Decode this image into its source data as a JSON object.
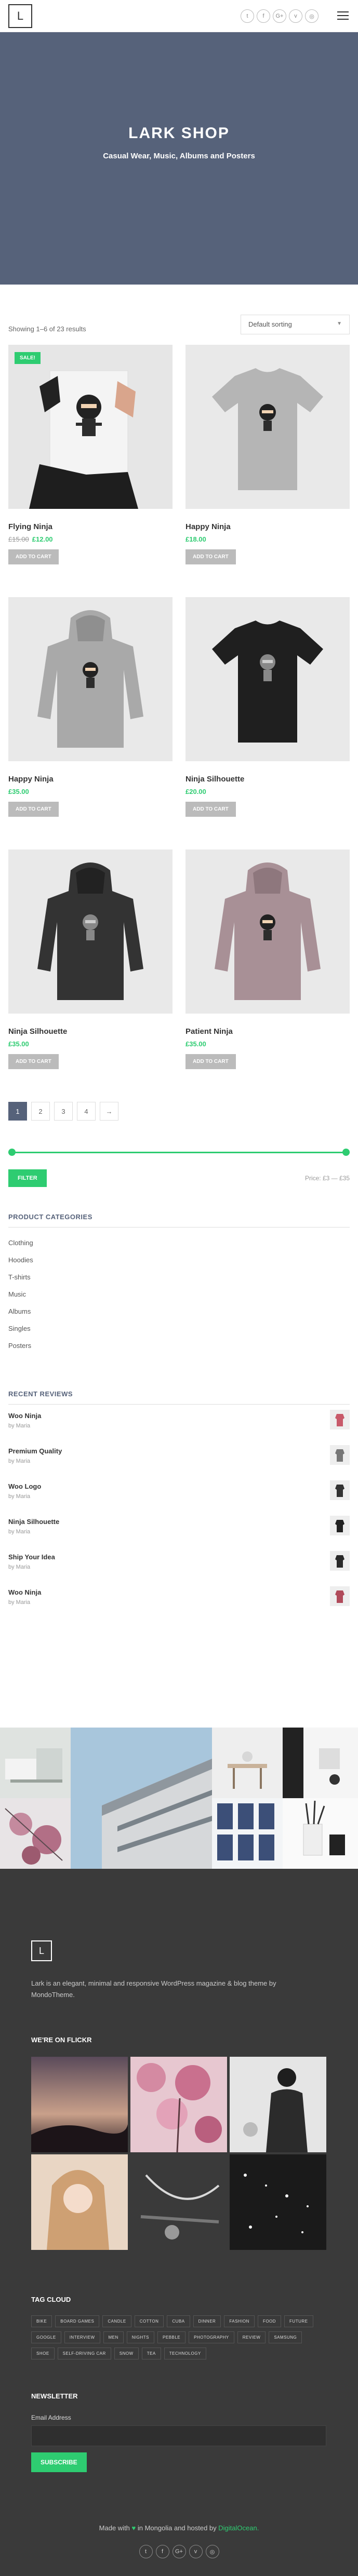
{
  "header": {
    "logo_letter": "L",
    "socials": [
      {
        "icon": "twitter-icon",
        "glyph": "t"
      },
      {
        "icon": "facebook-icon",
        "glyph": "f"
      },
      {
        "icon": "google-plus-icon",
        "glyph": "G+"
      },
      {
        "icon": "vimeo-icon",
        "glyph": "v"
      },
      {
        "icon": "dribbble-icon",
        "glyph": "◎"
      }
    ]
  },
  "hero": {
    "title": "LARK SHOP",
    "subtitle": "Casual Wear, Music, Albums and Posters"
  },
  "shop": {
    "result_count": "Showing 1–6 of 23 results",
    "sorting": "Default sorting",
    "sale_label": "SALE!",
    "add_to_cart": "ADD TO CART",
    "products": [
      {
        "name": "Flying Ninja",
        "old_price": "£15.00",
        "price": "£12.00",
        "sale": true,
        "kind": "poster",
        "color": "#e0e0e0"
      },
      {
        "name": "Happy Ninja",
        "old_price": "",
        "price": "£18.00",
        "sale": false,
        "kind": "tshirt",
        "color": "#b5b5b5"
      },
      {
        "name": "Happy Ninja",
        "old_price": "",
        "price": "£35.00",
        "sale": false,
        "kind": "hoodie",
        "color": "#a9a9a9"
      },
      {
        "name": "Ninja Silhouette",
        "old_price": "",
        "price": "£20.00",
        "sale": false,
        "kind": "tshirt",
        "color": "#1f1f1f"
      },
      {
        "name": "Ninja Silhouette",
        "old_price": "",
        "price": "£35.00",
        "sale": false,
        "kind": "hoodie",
        "color": "#333333"
      },
      {
        "name": "Patient Ninja",
        "old_price": "",
        "price": "£35.00",
        "sale": false,
        "kind": "hoodie",
        "color": "#a89096"
      }
    ],
    "pages": [
      "1",
      "2",
      "3",
      "4",
      "→"
    ]
  },
  "filter": {
    "button": "FILTER",
    "price_label": "Price: £3 — £35"
  },
  "categories": {
    "title": "PRODUCT CATEGORIES",
    "items": [
      "Clothing",
      "Hoodies",
      "T-shirts",
      "Music",
      "Albums",
      "Singles",
      "Posters"
    ]
  },
  "reviews": {
    "title": "RECENT REVIEWS",
    "items": [
      {
        "title": "Woo Ninja",
        "by": "by Maria",
        "thumb_color": "#c85a6a"
      },
      {
        "title": "Premium Quality",
        "by": "by Maria",
        "thumb_color": "#777777"
      },
      {
        "title": "Woo Logo",
        "by": "by Maria",
        "thumb_color": "#333333"
      },
      {
        "title": "Ninja Silhouette",
        "by": "by Maria",
        "thumb_color": "#222222"
      },
      {
        "title": "Ship Your Idea",
        "by": "by Maria",
        "thumb_color": "#2a2a2a"
      },
      {
        "title": "Woo Ninja",
        "by": "by Maria",
        "thumb_color": "#b04a5a"
      }
    ]
  },
  "footer": {
    "logo_letter": "L",
    "description": "Lark is an elegant, minimal and responsive WordPress magazine & blog theme by MondoTheme.",
    "flickr_title": "WE'RE ON FLICKR",
    "tag_cloud_title": "TAG CLOUD",
    "tags": [
      "BIKE",
      "BOARD GAMES",
      "CANDLE",
      "COTTON",
      "CUBA",
      "DINNER",
      "FASHION",
      "FOOD",
      "FUTURE",
      "GOOGLE",
      "INTERVIEW",
      "MEN",
      "NIGHTS",
      "PEBBLE",
      "PHOTOGRAPHY",
      "REVIEW",
      "SAMSUNG",
      "SHOE",
      "SELF-DRIVING CAR",
      "SNOW",
      "TEA",
      "TECHNOLOGY"
    ],
    "newsletter_title": "NEWSLETTER",
    "email_label": "Email Address",
    "subscribe": "SUBSCRIBE",
    "made_prefix": "Made with",
    "made_middle": "in Mongolia and hosted by",
    "made_link": "DigitalOcean.",
    "socials": [
      "t",
      "f",
      "G+",
      "v",
      "◎"
    ]
  },
  "colors": {
    "accent": "#2ecc71",
    "hero": "#56627a",
    "footer": "#3a3a3a"
  }
}
